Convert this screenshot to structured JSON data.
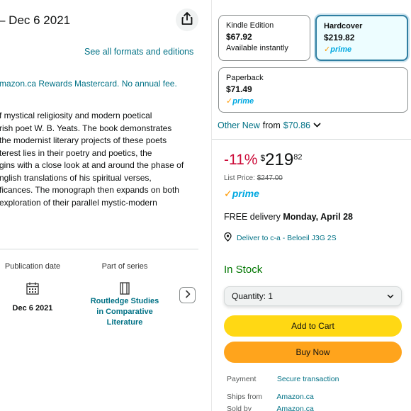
{
  "header": {
    "date_line": "– Dec 6 2021",
    "see_all_formats": "See all formats and editions",
    "promo": "mazon.ca Rewards Mastercard. No annual fee."
  },
  "description": [
    "f mystical religiosity and modern poetical",
    "rish poet W. B. Yeats. The book demonstrates",
    "the modernist literary projects of these poets",
    "terest lies in their poetry and poetics, the",
    "gins with a close look at and around the phase of",
    "nglish translations of his spiritual verses,",
    "ficances. The monograph then expands on both",
    "exploration of their parallel mystic-modern"
  ],
  "attributes": {
    "publication": {
      "label": "Publication date",
      "value": "Dec 6 2021",
      "icon": "calendar-icon"
    },
    "series": {
      "label": "Part of series",
      "value_lines": [
        "Routledge Studies",
        "in Comparative",
        "Literature"
      ],
      "icon": "book-icon"
    }
  },
  "formats": [
    {
      "name": "Kindle Edition",
      "price": "$67.92",
      "sub": "Available instantly",
      "selected": false
    },
    {
      "name": "Hardcover",
      "price": "$219.82",
      "prime": "prime",
      "selected": true
    },
    {
      "name": "Paperback",
      "price": "$71.49",
      "prime": "prime",
      "selected": false
    }
  ],
  "other_new": {
    "label": "Other New",
    "from": "from",
    "price": "$70.86"
  },
  "buybox": {
    "discount": "-11%",
    "currency": "$",
    "price_whole": "219",
    "price_fraction": "82",
    "list_price_label": "List Price:",
    "list_price": "$247.00",
    "prime": "prime",
    "delivery_prefix": "FREE delivery",
    "delivery_date": "Monday, April 28",
    "deliver_to": "Deliver to c-a - Beloeil J3G 2S",
    "stock": "In Stock",
    "quantity_label": "Quantity:",
    "quantity_value": "1",
    "add_to_cart": "Add to Cart",
    "buy_now": "Buy Now",
    "info": [
      {
        "key": "Payment",
        "value": "Secure transaction"
      },
      {
        "key": "Ships from",
        "value": "Amazon.ca"
      },
      {
        "key": "Sold by",
        "value": "Amazon.ca"
      }
    ]
  },
  "colors": {
    "link": "#007185",
    "discount": "#cc0c39",
    "in_stock": "#007600",
    "cart_button": "#ffd814",
    "buy_button": "#ffa41c",
    "prime": "#00a8e1"
  }
}
